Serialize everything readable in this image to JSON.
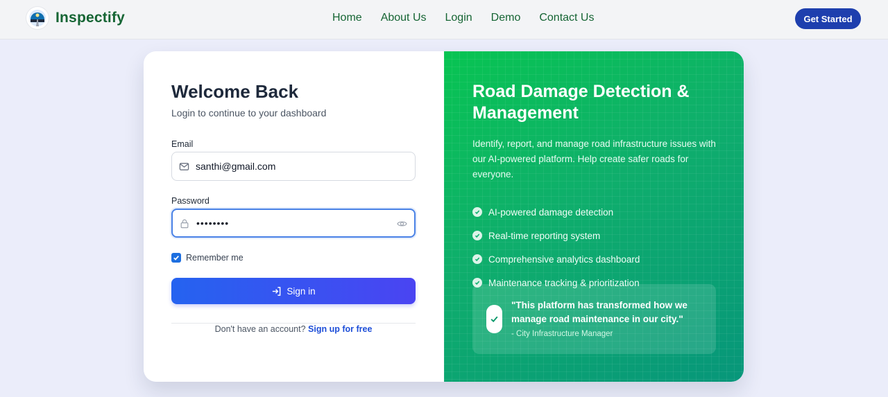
{
  "brand": {
    "name": "Inspectify"
  },
  "nav": {
    "items": [
      "Home",
      "About Us",
      "Login",
      "Demo",
      "Contact Us"
    ],
    "cta": "Get Started"
  },
  "login": {
    "title": "Welcome Back",
    "subtitle": "Login to continue to your dashboard",
    "email_label": "Email",
    "email_value": "santhi@gmail.com",
    "password_label": "Password",
    "password_value": "••••••••",
    "remember_label": "Remember me",
    "remember_checked": true,
    "signin_label": "Sign in",
    "signup_prompt": "Don't have an account?",
    "signup_link": "Sign up for free"
  },
  "promo": {
    "title": "Road Damage Detection & Management",
    "description": "Identify, report, and manage road infrastructure issues with our AI-powered platform. Help create safer roads for everyone.",
    "features": [
      "AI-powered damage detection",
      "Real-time reporting system",
      "Comprehensive analytics dashboard",
      "Maintenance tracking & prioritization"
    ],
    "testimonial": {
      "quote": "\"This platform has transformed how we manage road maintenance in our city.\"",
      "author": "- City Infrastructure Manager"
    }
  },
  "icons": [
    "logo-icon",
    "mail-icon",
    "lock-icon",
    "eye-icon",
    "checkbox-check-icon",
    "sign-in-icon",
    "check-circle-icon",
    "check-icon"
  ],
  "colors": {
    "brand_green": "#166534",
    "cta_blue": "#1e3fae",
    "promo_green": "#0fae6c",
    "signin_blue": "#2563f0"
  }
}
